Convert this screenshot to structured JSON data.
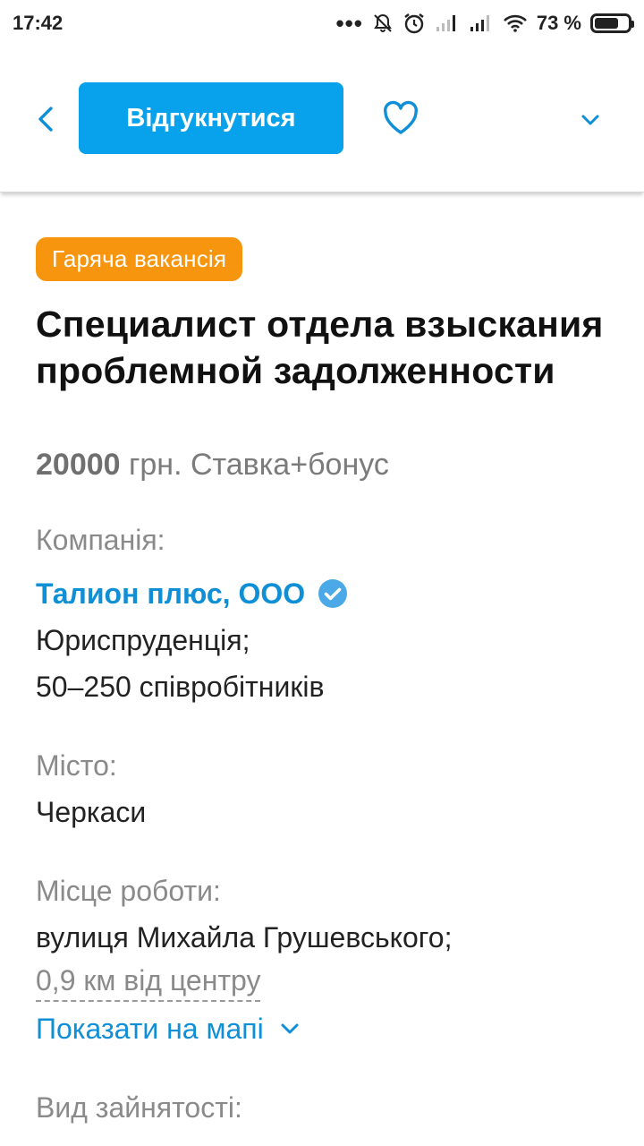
{
  "status_bar": {
    "time": "17:42",
    "dots": "•••",
    "battery_text": "73 %",
    "battery_level": 0.73,
    "icons": [
      "mute-bell-icon",
      "alarm-icon",
      "signal-icon",
      "signal-icon",
      "wifi-icon",
      "battery-icon"
    ]
  },
  "toolbar": {
    "back_icon": "chevron-left-icon",
    "respond_label": "Відгукнутися",
    "favorite_icon": "heart-outline-icon",
    "more_icon": "chevron-down-icon"
  },
  "colors": {
    "accent": "#08a1ec",
    "link": "#0f8fd6",
    "hot_badge": "#f8950e",
    "verified": "#4aa9e6"
  },
  "vacancy": {
    "hot_badge": "Гаряча вакансія",
    "title": "Специалист отдела взыскания проблемной задолженности",
    "salary_amount": "20000",
    "salary_rest": " грн. Ставка+бонус",
    "company_label": "Компанія:",
    "company_name": "Талион плюс, ООО",
    "company_industry": "Юриспруденція;",
    "company_size": "50–250 співробітників",
    "city_label": "Місто:",
    "city": "Черкаси",
    "workplace_label": "Місце роботи:",
    "workplace_address": "вулиця Михайла Грушевського;",
    "workplace_distance": "0,9 км від центру",
    "show_on_map": "Показати на мапі",
    "employment_label": "Вид зайнятості:"
  }
}
